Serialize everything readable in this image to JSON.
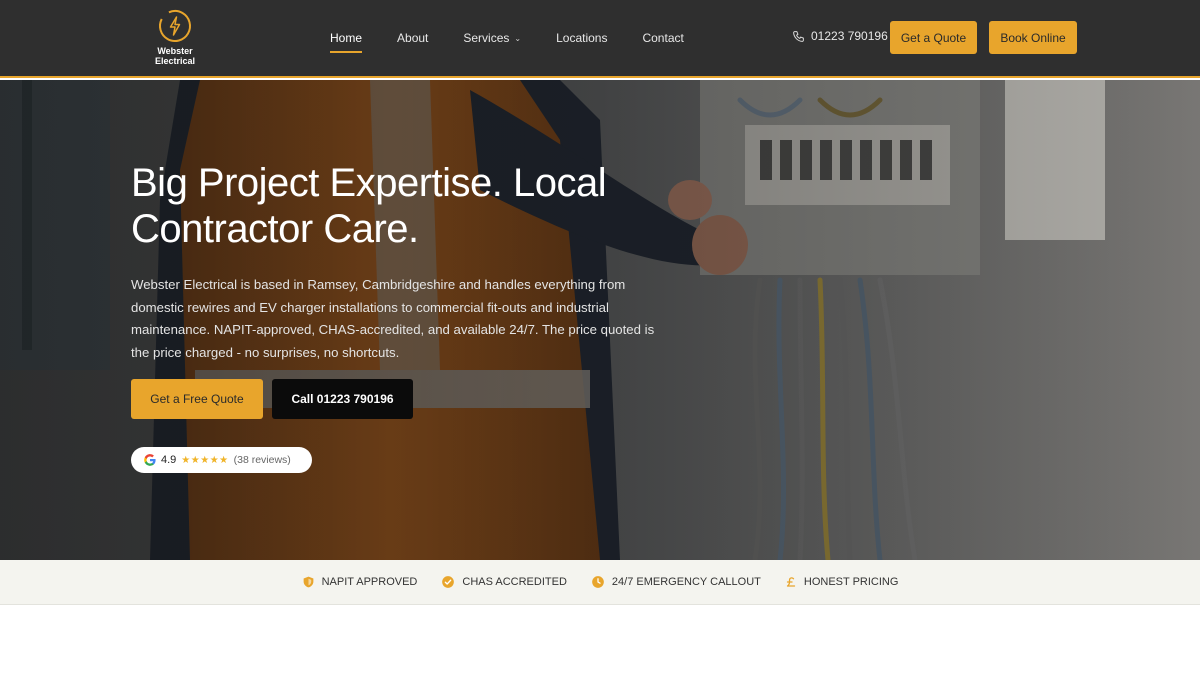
{
  "brand": {
    "name_line1": "Webster",
    "name_line2": "Electrical",
    "accent_color": "#e8a52c",
    "header_bg": "#2f2f2f"
  },
  "nav": {
    "items": [
      {
        "label": "Home",
        "active": true
      },
      {
        "label": "About"
      },
      {
        "label": "Services",
        "has_dropdown": true
      },
      {
        "label": "Locations"
      },
      {
        "label": "Contact"
      }
    ]
  },
  "header": {
    "phone": "01223 790196",
    "phone_icon": "phone-icon",
    "quote_label": "Get a Quote",
    "book_label": "Book Online"
  },
  "hero": {
    "title": "Big Project Expertise. Local Contractor Care.",
    "text": "Webster Electrical is based in Ramsey, Cambridgeshire and handles everything from domestic rewires and EV charger installations to commercial fit-outs and industrial maintenance. NAPIT-approved, CHAS-accredited, and available 24/7. The price quoted is the price charged - no surprises, no shortcuts.",
    "primary_btn": "Get a Free Quote",
    "secondary_btn": "Call 01223 790196",
    "review": {
      "icon": "google-icon",
      "rating": "4.9",
      "stars": "★★★★★",
      "count": "(38 reviews)"
    }
  },
  "trust_bar": [
    {
      "label": "NAPIT APPROVED",
      "icon": "shield-icon"
    },
    {
      "label": "CHAS ACCREDITED",
      "icon": "check-circle-icon"
    },
    {
      "label": "24/7 EMERGENCY CALLOUT",
      "icon": "clock-icon"
    },
    {
      "label": "HONEST PRICING",
      "icon": "pound-icon"
    }
  ]
}
